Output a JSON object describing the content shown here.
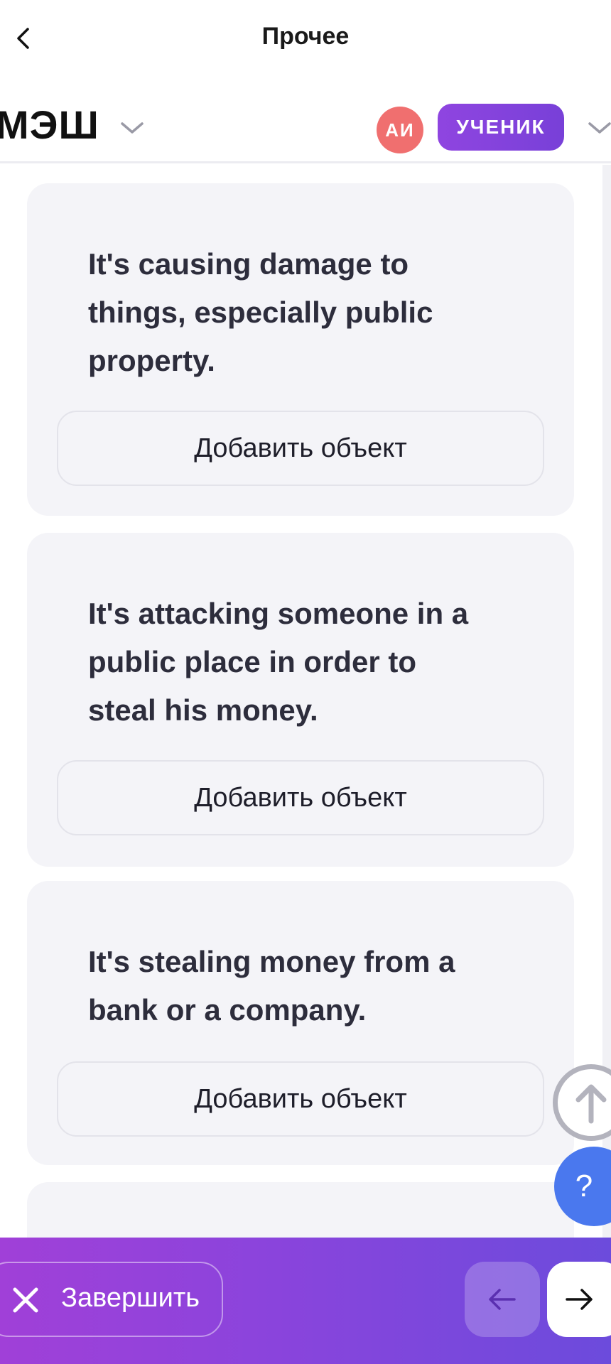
{
  "nav": {
    "title": "Прочее"
  },
  "header": {
    "logo": "МЭШ",
    "avatar_initials": "АИ",
    "role": "УЧЕНИК"
  },
  "cards": [
    {
      "text": "It's causing damage to things, especially public property.",
      "button_label": "Добавить объект"
    },
    {
      "text": "It's attacking someone in a public place in order to steal his money.",
      "button_label": "Добавить объект"
    },
    {
      "text": "It's stealing money from a bank or a company.",
      "button_label": "Добавить объект"
    }
  ],
  "floating": {
    "help_label": "?"
  },
  "bottom_bar": {
    "finish_label": "Завершить"
  },
  "icons": {
    "back": "chevron-left-icon",
    "logo_dropdown": "chevron-down-icon",
    "role_dropdown": "chevron-down-icon",
    "scroll_top": "arrow-up-icon",
    "finish": "close-icon",
    "prev": "arrow-left-icon",
    "next": "arrow-right-icon"
  },
  "colors": {
    "accent_purple": "#8f45e0",
    "avatar_red": "#f06f6f",
    "help_blue": "#4a78ee",
    "card_bg": "#f4f4f8"
  }
}
